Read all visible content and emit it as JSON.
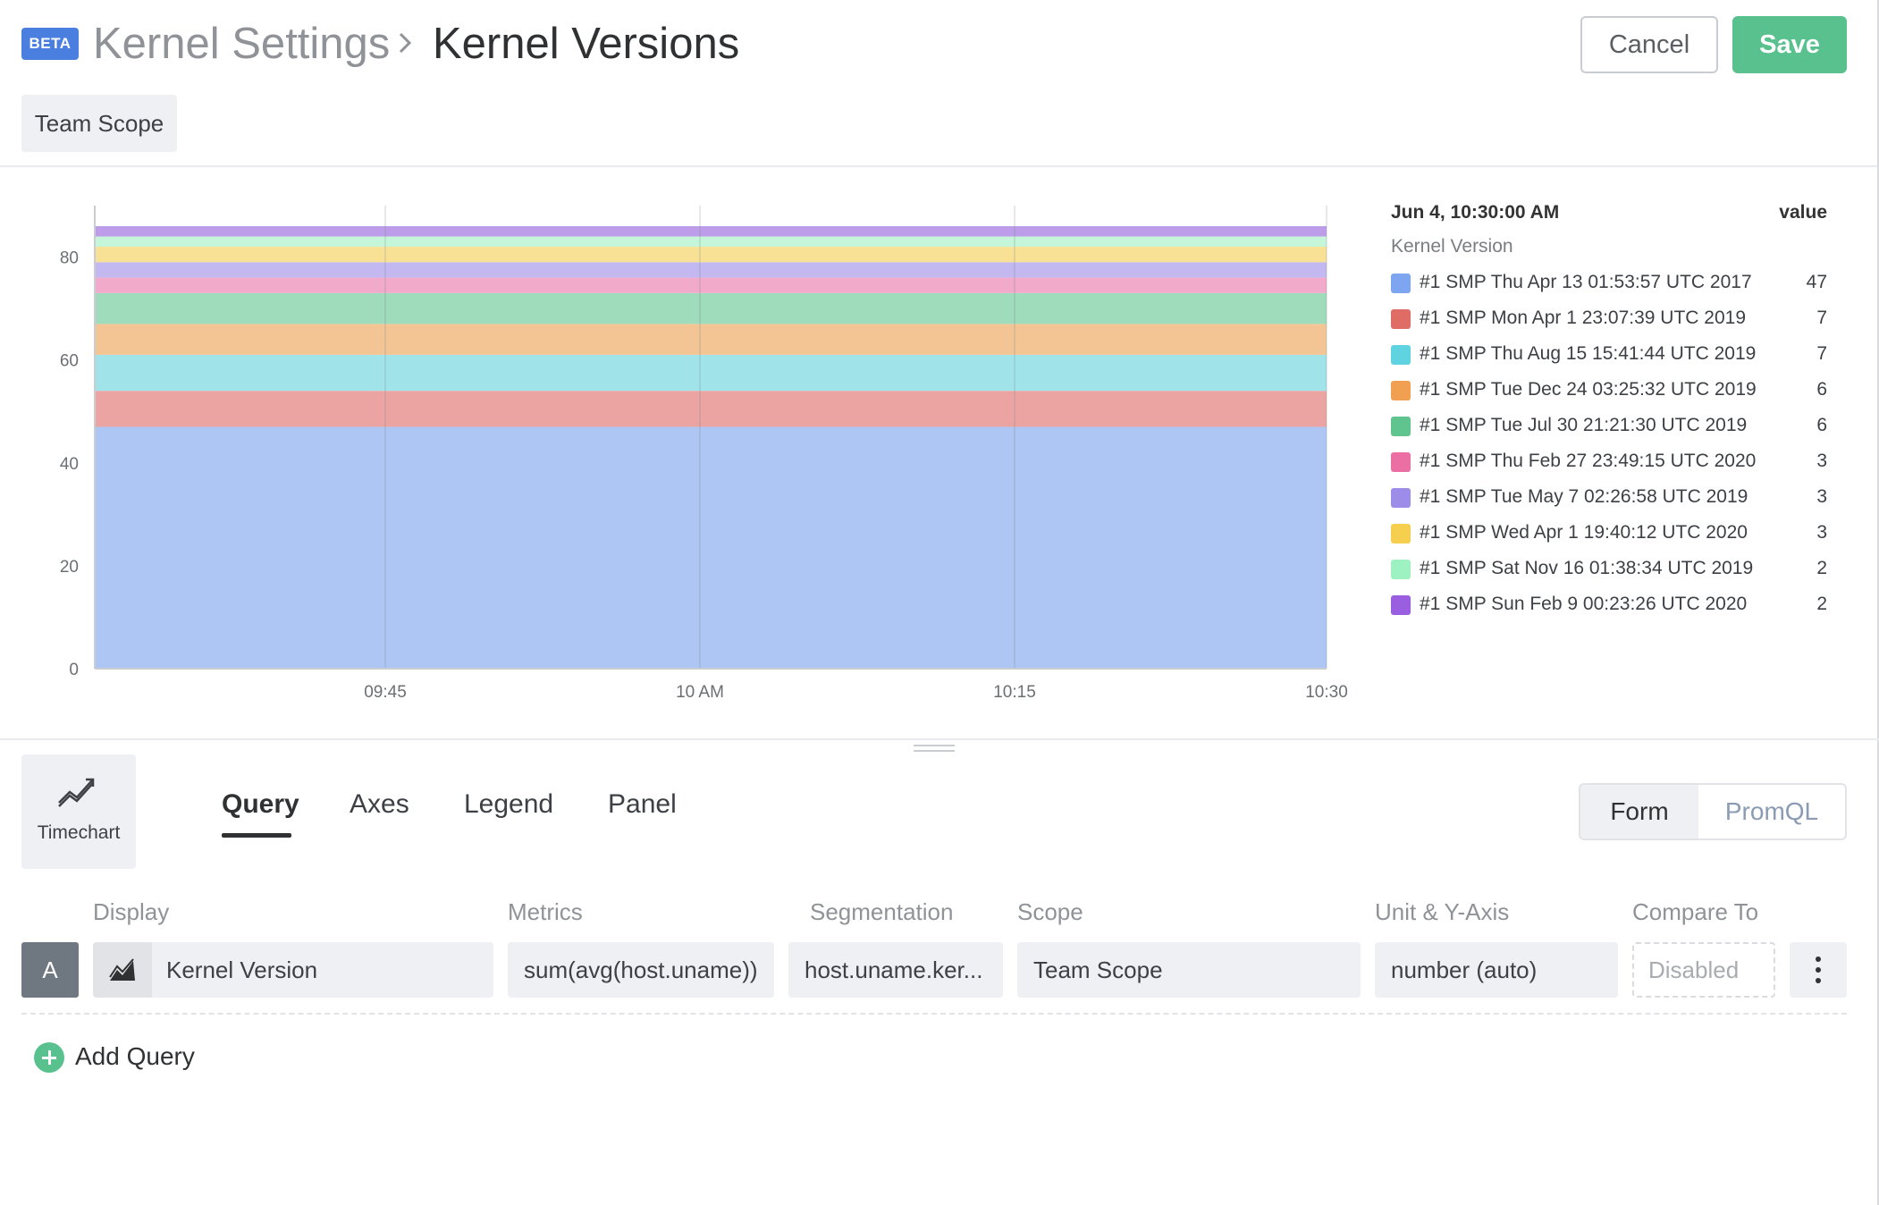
{
  "header": {
    "badge": "BETA",
    "breadcrumb_parent": "Kernel Settings",
    "breadcrumb_current": "Kernel Versions",
    "cancel_label": "Cancel",
    "save_label": "Save",
    "scope_label": "Team Scope"
  },
  "colors": {
    "accent_green": "#58c18e",
    "beta_blue": "#4a7fe0"
  },
  "chart_data": {
    "type": "area",
    "stacked": true,
    "x": [
      "09:45",
      "10 AM",
      "10:15",
      "10:30"
    ],
    "xlim": [
      "09:30",
      "10:30"
    ],
    "ylim": [
      0,
      90
    ],
    "yticks": [
      0,
      20,
      40,
      60,
      80
    ],
    "grid": true,
    "legend_position": "right",
    "series": [
      {
        "name": "#1 SMP Thu Apr 13 01:53:57 UTC 2017",
        "value": 47,
        "color": "#7ea6f0",
        "fill": "#aec6f4"
      },
      {
        "name": "#1 SMP Mon Apr 1 23:07:39 UTC 2019",
        "value": 7,
        "color": "#e06c66",
        "fill": "#eba4a1"
      },
      {
        "name": "#1 SMP Thu Aug 15 15:41:44 UTC 2019",
        "value": 7,
        "color": "#5fd3df",
        "fill": "#a0e4ea"
      },
      {
        "name": "#1 SMP Tue Dec 24 03:25:32 UTC 2019",
        "value": 6,
        "color": "#f0a050",
        "fill": "#f4c594"
      },
      {
        "name": "#1 SMP Tue Jul 30 21:21:30 UTC 2019",
        "value": 6,
        "color": "#5fc48e",
        "fill": "#9edcbb"
      },
      {
        "name": "#1 SMP Thu Feb 27 23:49:15 UTC 2020",
        "value": 3,
        "color": "#ec6fa4",
        "fill": "#f2aacb"
      },
      {
        "name": "#1 SMP Tue May 7 02:26:58 UTC 2019",
        "value": 3,
        "color": "#9d8de8",
        "fill": "#c3b9f0"
      },
      {
        "name": "#1 SMP Wed Apr 1 19:40:12 UTC 2020",
        "value": 3,
        "color": "#f5cf4d",
        "fill": "#f8e094"
      },
      {
        "name": "#1 SMP Sat Nov 16 01:38:34 UTC 2019",
        "value": 2,
        "color": "#9ef2c2",
        "fill": "#c6f6da"
      },
      {
        "name": "#1 SMP Sun Feb 9 00:23:26 UTC 2020",
        "value": 2,
        "color": "#9a5fe0",
        "fill": "#bd9ce9"
      }
    ]
  },
  "legend": {
    "timestamp": "Jun 4, 10:30:00 AM",
    "value_header": "value",
    "group_label": "Kernel Version"
  },
  "editor": {
    "chart_type_label": "Timechart",
    "tabs": [
      "Query",
      "Axes",
      "Legend",
      "Panel"
    ],
    "mode_form": "Form",
    "mode_promql": "PromQL",
    "columns": {
      "display": "Display",
      "metrics": "Metrics",
      "segmentation": "Segmentation",
      "scope": "Scope",
      "unit": "Unit & Y-Axis",
      "compare": "Compare To"
    },
    "query": {
      "letter": "A",
      "display": "Kernel Version",
      "metrics": "sum(avg(host.uname))",
      "segmentation": "host.uname.ker...",
      "scope": "Team Scope",
      "unit": "number (auto)",
      "compare": "Disabled"
    },
    "add_query_label": "Add Query"
  }
}
